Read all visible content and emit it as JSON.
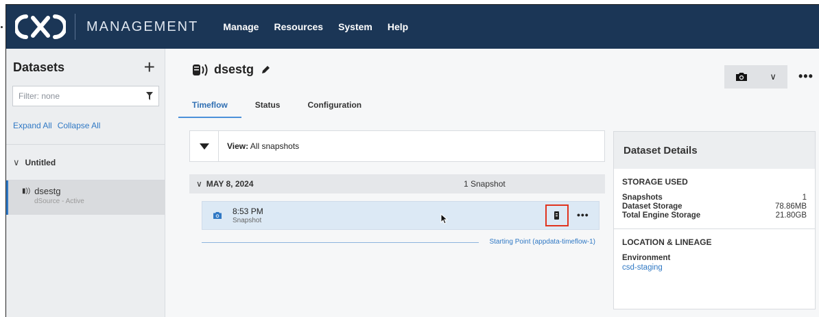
{
  "header": {
    "product": "MANAGEMENT",
    "nav": [
      "Manage",
      "Resources",
      "System",
      "Help"
    ]
  },
  "sidebar": {
    "title": "Datasets",
    "filter_placeholder": "Filter: none",
    "expand_all": "Expand All",
    "collapse_all": "Collapse All",
    "group": "Untitled",
    "items": [
      {
        "name": "dsestg",
        "subtitle": "dSource - Active"
      }
    ]
  },
  "main": {
    "dataset_name": "dsestg",
    "tabs": [
      "Timeflow",
      "Status",
      "Configuration"
    ],
    "active_tab": "Timeflow",
    "view_prefix": "View:",
    "view_value": "All snapshots",
    "date_group": "MAY 8, 2024",
    "snapshot_count": "1 Snapshot",
    "snapshot": {
      "time": "8:53 PM",
      "kind": "Snapshot"
    },
    "timeline_label": "Starting Point (appdata-timeflow-1)"
  },
  "details": {
    "title": "Dataset Details",
    "storage_heading": "STORAGE USED",
    "storage_rows": [
      {
        "label": "Snapshots",
        "value": "1"
      },
      {
        "label": "Dataset Storage",
        "value": "78.86MB"
      },
      {
        "label": "Total Engine Storage",
        "value": "21.80GB"
      }
    ],
    "location_heading": "LOCATION & LINEAGE",
    "environment_label": "Environment",
    "environment_value": "csd-staging"
  },
  "colors": {
    "header_bg": "#1b3656",
    "accent": "#2f78c4",
    "highlight_border": "#e0331e",
    "snapshot_row_bg": "#dce9f5"
  },
  "icons": [
    "logo-icon",
    "add-icon",
    "filter-icon",
    "chevron-down-icon",
    "dataset-icon",
    "edit-pencil-icon",
    "camera-icon",
    "more-icon",
    "caret-down-icon",
    "provision-icon",
    "cursor-icon"
  ]
}
